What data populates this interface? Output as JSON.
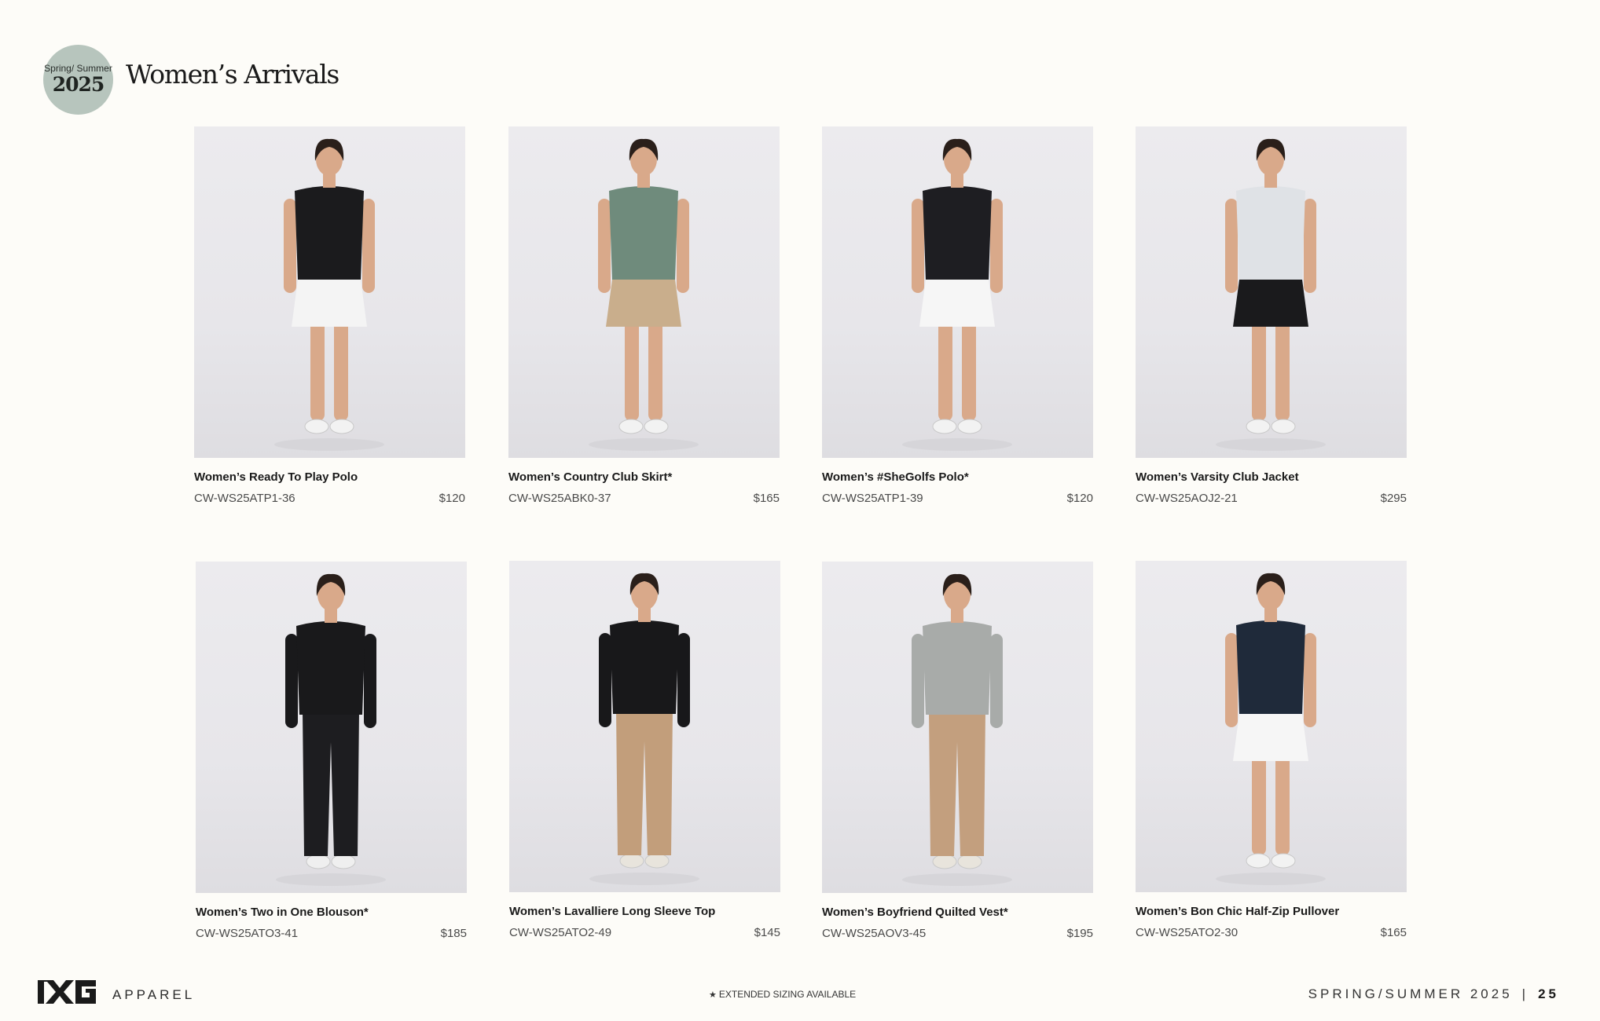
{
  "header": {
    "badge_season": "Spring/ Summer",
    "badge_year": "2025",
    "title": "Women’s Arrivals"
  },
  "products": [
    {
      "name": "Women’s Ready To Play Polo",
      "sku": "CW-WS25ATP1-36",
      "price": "$120",
      "top_color": "#1b1b1d",
      "bottom_color": "#f4f4f4",
      "shoe_color": "#f2f2f2"
    },
    {
      "name": "Women’s Country Club Skirt*",
      "sku": "CW-WS25ABK0-37",
      "price": "$165",
      "top_color": "#6f8b7c",
      "bottom_color": "#c9ae8c",
      "shoe_color": "#f2f2f2"
    },
    {
      "name": "Women’s #SheGolfs Polo*",
      "sku": "CW-WS25ATP1-39",
      "price": "$120",
      "top_color": "#1e1e22",
      "bottom_color": "#f6f6f6",
      "shoe_color": "#f2f2f2"
    },
    {
      "name": "Women’s Varsity Club Jacket",
      "sku": "CW-WS25AOJ2-21",
      "price": "$295",
      "top_color": "#dfe2e6",
      "bottom_color": "#1a1a1c",
      "shoe_color": "#f2f2f2"
    },
    {
      "name": "Women’s Two in One Blouson*",
      "sku": "CW-WS25ATO3-41",
      "price": "$185",
      "top_color": "#19191b",
      "bottom_color": "#1d1d20",
      "shoe_color": "#efefef"
    },
    {
      "name": "Women’s Lavalliere Long Sleeve Top",
      "sku": "CW-WS25ATO2-49",
      "price": "$145",
      "top_color": "#18181a",
      "bottom_color": "#c29e7b",
      "shoe_color": "#e8e4dc"
    },
    {
      "name": "Women’s Boyfriend Quilted Vest*",
      "sku": "CW-WS25AOV3-45",
      "price": "$195",
      "top_color": "#a8aba9",
      "bottom_color": "#c39f7e",
      "shoe_color": "#e8e4dc"
    },
    {
      "name": "Women’s Bon Chic Half-Zip Pullover",
      "sku": "CW-WS25ATO2-30",
      "price": "$165",
      "top_color": "#1f2a3a",
      "bottom_color": "#f6f6f6",
      "shoe_color": "#f2f2f2"
    }
  ],
  "footer": {
    "brand_logo": "PXG",
    "brand_label": "APPAREL",
    "footnote_icon": "star-icon",
    "footnote": "EXTENDED SIZING AVAILABLE",
    "season": "SPRING/SUMMER 2025",
    "separator": "|",
    "page_number": "25"
  }
}
